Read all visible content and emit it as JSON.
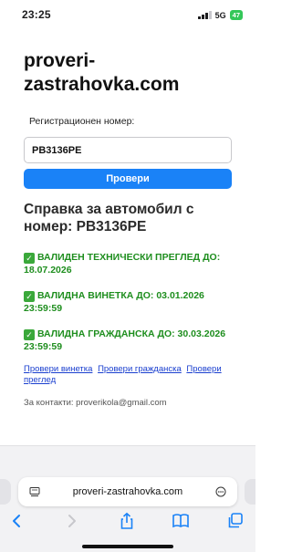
{
  "status_bar": {
    "time": "23:25",
    "network": "5G",
    "battery": "47"
  },
  "page": {
    "site_title": "proveri-zastrahovka.com",
    "reg_label": "Регистрационен номер:",
    "reg_value": "PB3136PE",
    "check_button": "Провери",
    "report_heading": "Справка за автомобил с номер: PB3136PE",
    "statuses": [
      {
        "text": "ВАЛИДЕН ТЕХНИЧЕСКИ ПРЕГЛЕД ДО: 18.07.2026"
      },
      {
        "text": "ВАЛИДНА ВИНЕТКА ДО: 03.01.2026 23:59:59"
      },
      {
        "text": "ВАЛИДНА ГРАЖДАНСКА ДО: 30.03.2026 23:59:59"
      }
    ],
    "links": [
      "Провери винетка",
      "Провери гражданска",
      "Провери преглед"
    ],
    "contacts": "За контакти: proverikola@gmail.com"
  },
  "browser": {
    "url": "proveri-zastrahovka.com",
    "icons": [
      "reader-icon",
      "more-icon",
      "back-icon",
      "forward-icon",
      "share-icon",
      "bookmarks-icon",
      "tabs-icon"
    ],
    "accent_color": "#1a82f7"
  }
}
